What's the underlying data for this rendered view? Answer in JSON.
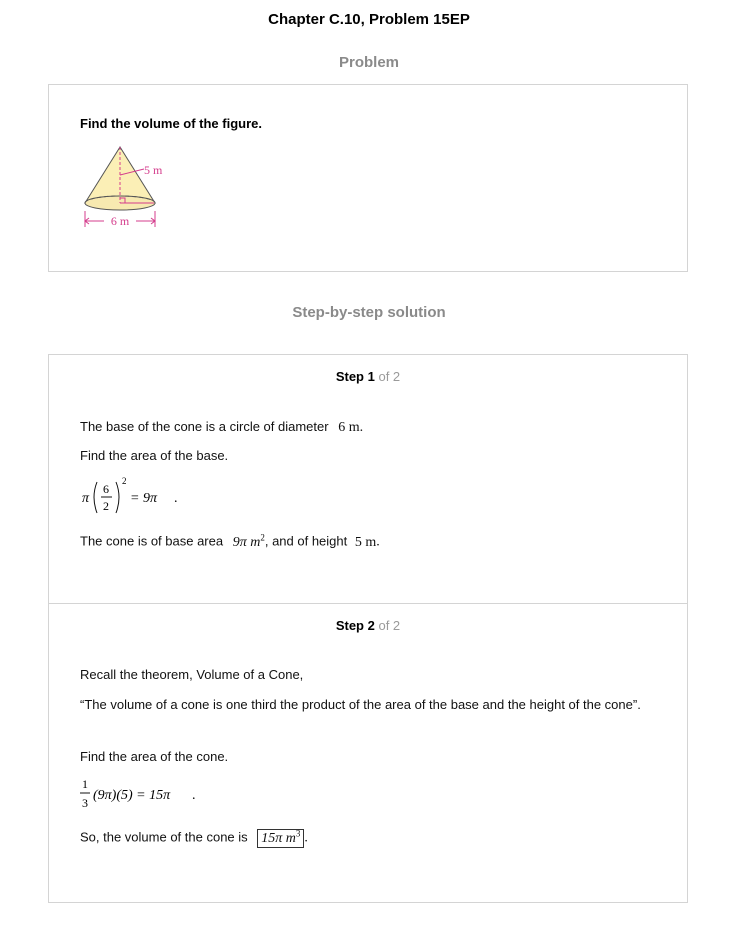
{
  "header": {
    "title": "Chapter C.10, Problem 15EP"
  },
  "problem": {
    "heading": "Problem",
    "statement": "Find the volume of the figure.",
    "figure": {
      "height_label": "5 m",
      "diameter_label": "6 m"
    }
  },
  "solution": {
    "heading": "Step-by-step solution",
    "steps": [
      {
        "label": "Step 1",
        "of": "of 2",
        "text1_prefix": "The base of the cone is a circle of diameter",
        "diameter": "6 m",
        "text2": "Find the area of the base.",
        "formula": {
          "pi": "π",
          "num": "6",
          "den": "2",
          "exp": "2",
          "result": "= 9π"
        },
        "text3_prefix": "The cone is of base area",
        "area": "9π m",
        "area_exp": "2",
        "text3_mid": ", and of height",
        "height": "5 m"
      },
      {
        "label": "Step 2",
        "of": "of 2",
        "text1": "Recall the theorem, Volume of a Cone,",
        "text2": "“The volume of a cone is one third the product of the area of the base and the height of the cone”.",
        "text3": "Find the area of the cone.",
        "formula": {
          "num": "1",
          "den": "3",
          "rest": "(9π)(5) = 15π"
        },
        "text4_prefix": "So, the volume of the cone is",
        "answer": "15π m",
        "answer_exp": "3"
      }
    ]
  }
}
